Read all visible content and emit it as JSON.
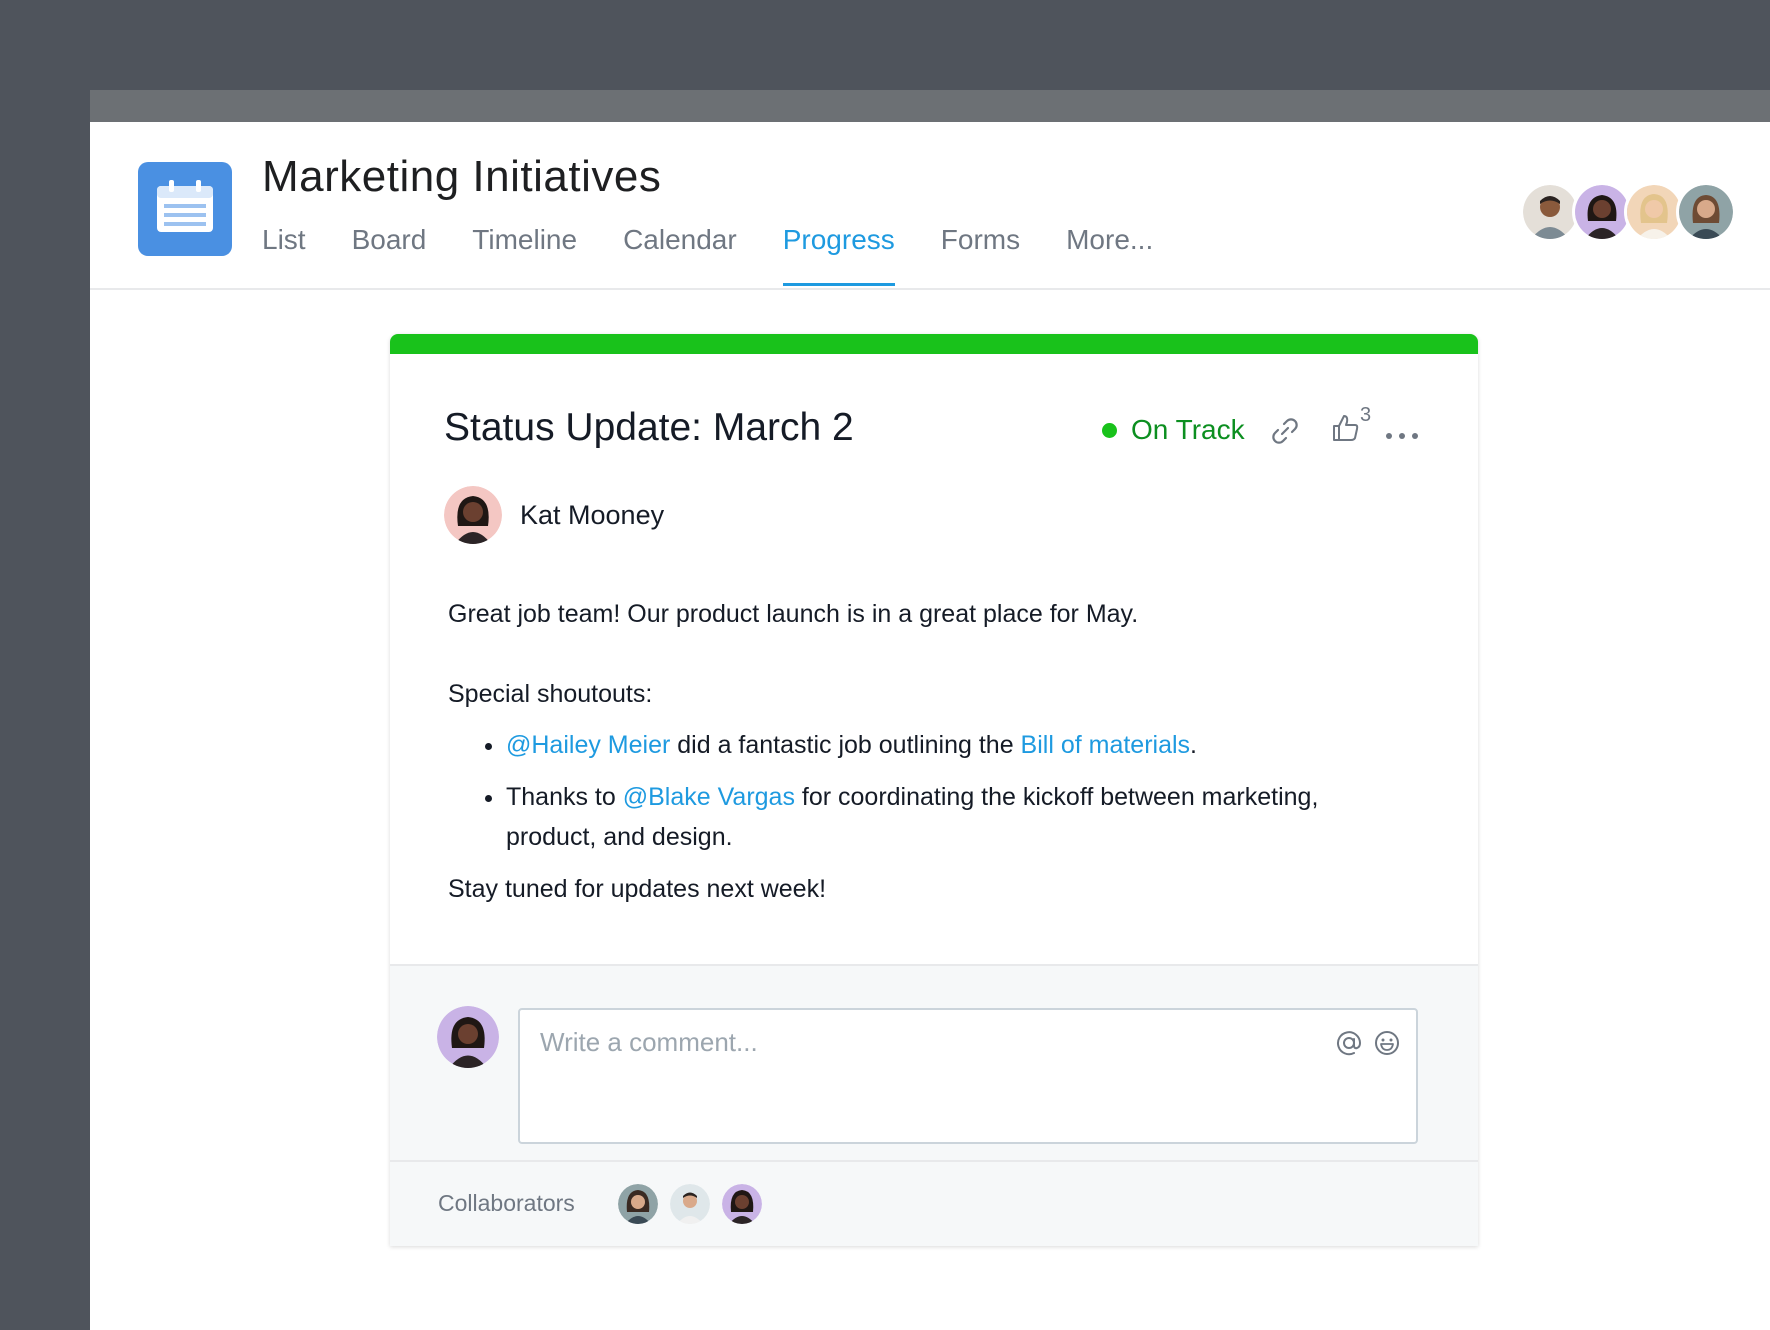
{
  "project": {
    "title": "Marketing Initiatives",
    "icon": "calendar-icon",
    "icon_color": "#4a90e2"
  },
  "tabs": [
    {
      "label": "List"
    },
    {
      "label": "Board"
    },
    {
      "label": "Timeline"
    },
    {
      "label": "Calendar"
    },
    {
      "label": "Progress",
      "active": true
    },
    {
      "label": "Forms"
    },
    {
      "label": "More..."
    }
  ],
  "accent_color": "#1e9ae0",
  "members": [
    "member-avatar",
    "member-avatar",
    "member-avatar",
    "member-avatar"
  ],
  "status_update": {
    "title": "Status Update: March 2",
    "status": "On Track",
    "status_color": "#19c21b",
    "like_count": "3",
    "author": "Kat Mooney",
    "body": {
      "intro": "Great job team! Our product launch is in a great place for May.",
      "shoutouts_heading": "Special shoutouts:",
      "item1": {
        "mention": "@Hailey Meier",
        "text": " did a fantastic job outlining the ",
        "link": "Bill of materials",
        "end": "."
      },
      "item2": {
        "start": "Thanks to ",
        "mention": "@Blake Vargas",
        "text": " for coordinating the kickoff between marketing, product, and design."
      },
      "closing": "Stay tuned for updates next week!"
    }
  },
  "comment": {
    "placeholder": "Write a comment...",
    "value": ""
  },
  "collaborators": {
    "label": "Collaborators"
  }
}
